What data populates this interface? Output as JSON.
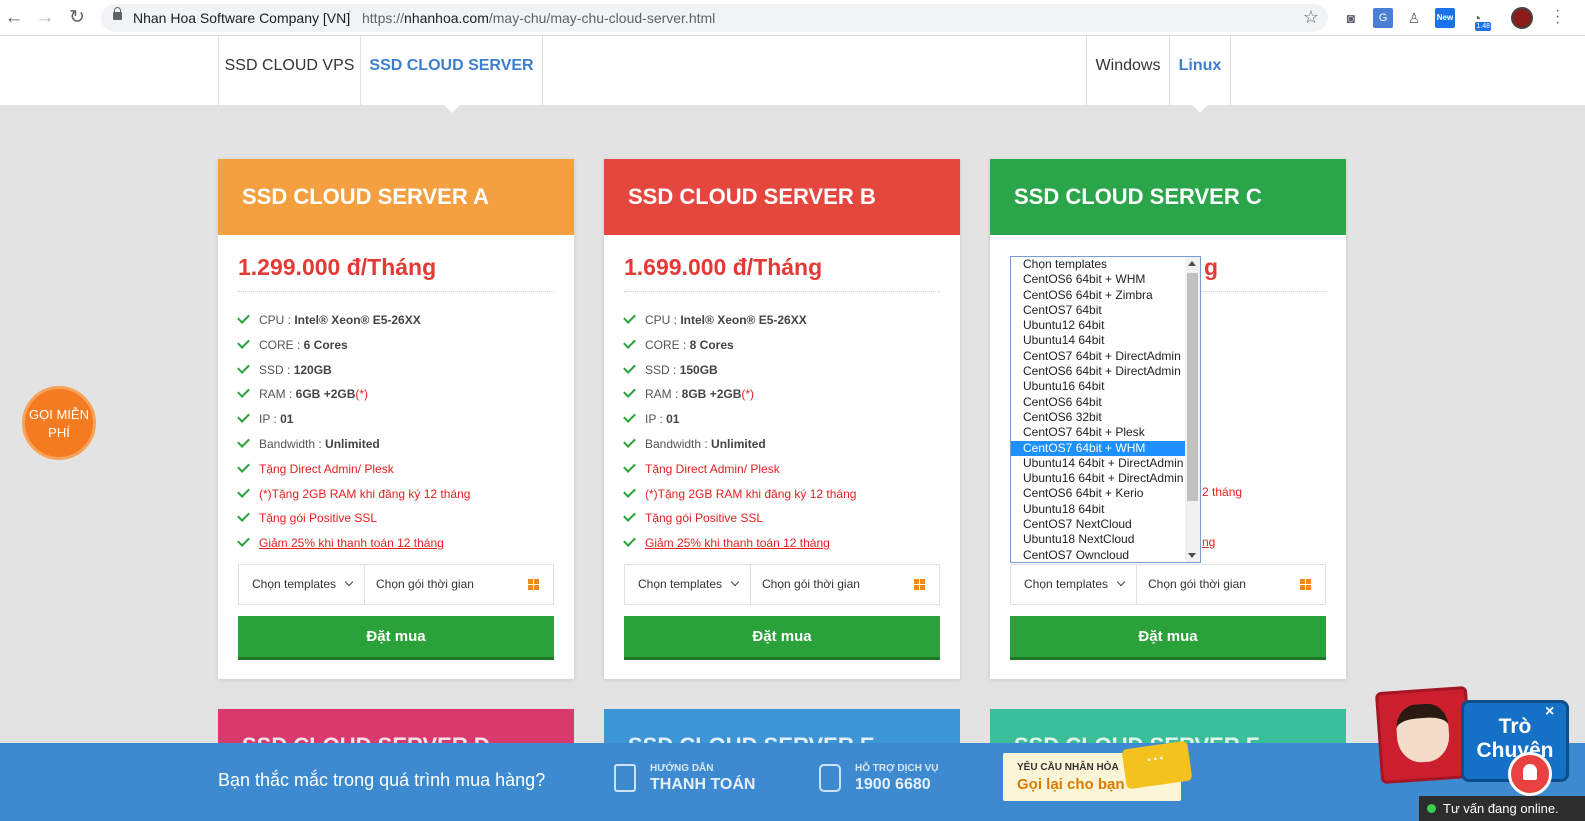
{
  "browser": {
    "site_name": "Nhan Hoa Software Company [VN]",
    "url_scheme": "https://",
    "url_host": "nhanhoa.com",
    "url_path": "/may-chu/may-chu-cloud-server.html",
    "ext_new": "New",
    "ext_badge": "1.48"
  },
  "subnav": {
    "tabs_left": [
      "SSD CLOUD VPS",
      "SSD CLOUD SERVER"
    ],
    "tabs_right": [
      "Windows",
      "Linux"
    ]
  },
  "cards": [
    {
      "title": "SSD CLOUD SERVER A",
      "color": "#f4a040",
      "price": "1.299.000 đ/Tháng",
      "cpu_label": "CPU : ",
      "cpu": "Intel® Xeon® E5-26XX",
      "core_label": "CORE : ",
      "core": "6 Cores",
      "ssd_label": "SSD : ",
      "ssd": "120GB",
      "ram_label": "RAM : ",
      "ram": "6GB",
      "ram_bonus": "+2GB",
      "ram_note": "(*)",
      "ip_label": "IP : ",
      "ip": "01",
      "bw_label": "Bandwidth : ",
      "bw": "Unlimited",
      "promo1": "Tặng Direct Admin/ Plesk",
      "promo2": "(*)Tặng 2GB RAM khi đăng ký 12 tháng",
      "promo3": "Tặng gói Positive SSL",
      "promo4": "Giảm 25% khi thanh toán 12 tháng",
      "template_label": "Chọn templates",
      "time_label": "Chọn gói thời gian",
      "buy": "Đặt mua"
    },
    {
      "title": "SSD CLOUD SERVER B",
      "color": "#e5463e",
      "price": "1.699.000 đ/Tháng",
      "cpu_label": "CPU : ",
      "cpu": "Intel® Xeon® E5-26XX",
      "core_label": "CORE : ",
      "core": "8 Cores",
      "ssd_label": "SSD : ",
      "ssd": "150GB",
      "ram_label": "RAM : ",
      "ram": "8GB",
      "ram_bonus": "+2GB",
      "ram_note": "(*)",
      "ip_label": "IP : ",
      "ip": "01",
      "bw_label": "Bandwidth : ",
      "bw": "Unlimited",
      "promo1": "Tặng Direct Admin/ Plesk",
      "promo2": "(*)Tặng 2GB RAM khi đăng ký 12 tháng",
      "promo3": "Tặng gói Positive SSL",
      "promo4": "Giảm 25% khi thanh toán 12 tháng",
      "template_label": "Chọn templates",
      "time_label": "Chọn gói thời gian",
      "buy": "Đặt mua"
    },
    {
      "title": "SSD CLOUD SERVER C",
      "color": "#2aa54a",
      "price_visible": "g",
      "promo2_visible": "2 tháng",
      "promo4_visible": "ng",
      "template_label": "Chọn templates",
      "time_label": "Chọn gói thời gian",
      "buy": "Đặt mua"
    }
  ],
  "cards_row2": [
    {
      "title": "SSD CLOUD SERVER D",
      "color": "#d83a6e"
    },
    {
      "title": "SSD CLOUD SERVER E",
      "color": "#3c96d6"
    },
    {
      "title": "SSD CLOUD SERVER F",
      "color": "#3bbf9a"
    }
  ],
  "dropdown": {
    "options": [
      "Chọn templates",
      "CentOS6 64bit + WHM",
      "CentOS6 64bit + Zimbra",
      "CentOS7 64bit",
      "Ubuntu12 64bit",
      "Ubuntu14 64bit",
      "CentOS7 64bit + DirectAdmin",
      "CentOS6 64bit + DirectAdmin",
      "Ubuntu16 64bit",
      "CentOS6 64bit",
      "CentOS6 32bit",
      "CentOS7 64bit + Plesk",
      "CentOS7 64bit + WHM",
      "Ubuntu14 64bit + DirectAdmin",
      "Ubuntu16 64bit + DirectAdmin",
      "CentOS6 64bit + Kerio",
      "Ubuntu18 64bit",
      "CentOS7 NextCloud",
      "Ubuntu18 NextCloud",
      "CentOS7 Owncloud"
    ],
    "selected": "CentOS7 64bit + WHM"
  },
  "call_badge": "GỌI MIỄN PHÍ",
  "footer": {
    "question": "Bạn thắc mắc trong quá trình mua hàng?",
    "guide_small": "HƯỚNG DẪN",
    "guide_big": "THANH TOÁN",
    "support_small": "HỖ TRỢ DỊCH VỤ",
    "support_big": "1900 6680",
    "callme_small": "YÊU CẦU NHÂN HÒA",
    "callme_big": "Gọi lại cho bạn",
    "bubble": "···"
  },
  "chat": {
    "label_line1": "Trò",
    "label_line2": "Chuyện",
    "close": "×",
    "online": "Tư vấn đang online."
  }
}
